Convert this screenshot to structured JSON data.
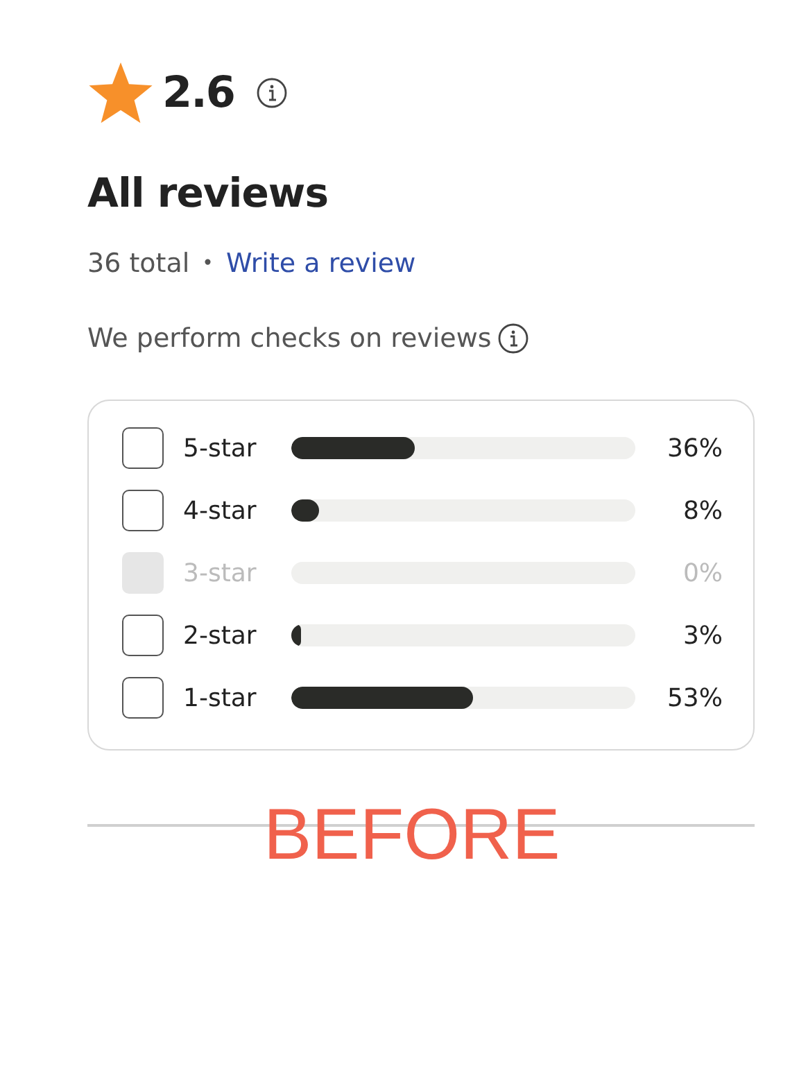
{
  "rating": {
    "value": "2.6"
  },
  "heading": "All reviews",
  "summary": {
    "total": "36 total",
    "separator": "•",
    "write_link": "Write a review"
  },
  "checks_note": "We perform checks on reviews",
  "filters": [
    {
      "label": "5-star",
      "checked": false,
      "disabled": false,
      "level": 0.36,
      "percent": "36%"
    },
    {
      "label": "4-star",
      "checked": false,
      "disabled": false,
      "level": 0.08,
      "percent": "8%"
    },
    {
      "label": "3-star",
      "checked": false,
      "disabled": true,
      "percent": "0%"
    },
    {
      "label": "2-star",
      "checked": false,
      "disabled": false,
      "level": 0.03,
      "percent": "3%"
    },
    {
      "label": "1-star",
      "checked": false,
      "disabled": false,
      "level": 0.53,
      "percent": "53%"
    }
  ],
  "annotation": "BEFORE"
}
